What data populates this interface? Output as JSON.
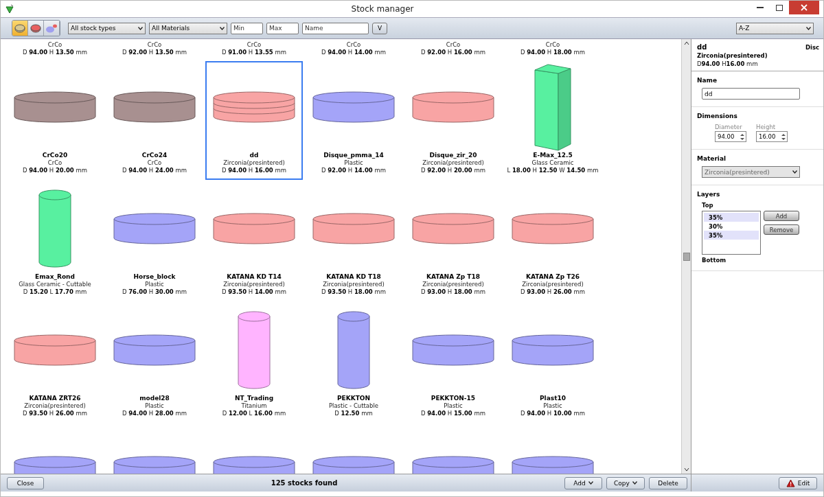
{
  "window": {
    "title": "Stock manager"
  },
  "toolbar": {
    "view_modes": [
      {
        "kind": "disc",
        "color": "#d8c890",
        "selected": true
      },
      {
        "kind": "disc",
        "color": "#e86060",
        "selected": false
      },
      {
        "kind": "pair",
        "color": "#a0a0f0",
        "selected": false
      }
    ],
    "type_filter": "All stock types",
    "material_filter": "All Materials",
    "min": {
      "placeholder": "Min"
    },
    "max": {
      "placeholder": "Max"
    },
    "name": {
      "placeholder": "Name"
    },
    "apply_button": "V",
    "sort": "A-Z"
  },
  "partial_row": [
    {
      "material": "CrCo",
      "dims": "D **94.00** H **13.50** mm"
    },
    {
      "material": "CrCo",
      "dims": "D **92.00** H **13.50** mm"
    },
    {
      "material": "CrCo",
      "dims": "D **91.00** H **13.55** mm"
    },
    {
      "material": "CrCo",
      "dims": "D **94.00** H **14.00** mm"
    },
    {
      "material": "CrCo",
      "dims": "D **92.00** H **16.00** mm"
    },
    {
      "material": "CrCo",
      "dims": "D **94.00** H **18.00** mm"
    }
  ],
  "stocks": [
    {
      "name": "CrCo20",
      "material": "CrCo",
      "dims": "D **94.00** H **20.00** mm",
      "kind": "disc",
      "color": "#a89090",
      "selected": false
    },
    {
      "name": "CrCo24",
      "material": "CrCo",
      "dims": "D **94.00** H **24.00** mm",
      "kind": "disc",
      "color": "#a89090",
      "selected": false
    },
    {
      "name": "dd",
      "material": "Zirconia(presintered)",
      "dims": "D **94.00** H **16.00** mm",
      "kind": "layered",
      "color": "#f8a4a4",
      "selected": true
    },
    {
      "name": "Disque_pmma_14",
      "material": "Plastic",
      "dims": "D **92.00** H **14.00** mm",
      "kind": "disc",
      "color": "#a4a4f8",
      "selected": false
    },
    {
      "name": "Disque_zir_20",
      "material": "Zirconia(presintered)",
      "dims": "D **92.00** H **20.00** mm",
      "kind": "disc",
      "color": "#f8a4a4",
      "selected": false
    },
    {
      "name": "E-Max_12.5",
      "material": "Glass Ceramic",
      "dims": "L **18.00** H **12.50** W **14.50** mm",
      "kind": "block",
      "color": "#58f0a0",
      "selected": false
    },
    {
      "name": "Emax_Rond",
      "material": "Glass Ceramic - Cuttable",
      "dims": "D **15.20** L **17.70** mm",
      "kind": "rod",
      "color": "#58f0a0",
      "selected": false
    },
    {
      "name": "Horse_block",
      "material": "Plastic",
      "dims": "D **76.00** H **30.00** mm",
      "kind": "disc",
      "color": "#a4a4f8",
      "selected": false
    },
    {
      "name": "KATANA KD T14",
      "material": "Zirconia(presintered)",
      "dims": "D **93.50** H **14.00** mm",
      "kind": "disc",
      "color": "#f8a4a4",
      "selected": false
    },
    {
      "name": "KATANA KD T18",
      "material": "Zirconia(presintered)",
      "dims": "D **93.50** H **18.00** mm",
      "kind": "disc",
      "color": "#f8a4a4",
      "selected": false
    },
    {
      "name": "KATANA Zp T18",
      "material": "Zirconia(presintered)",
      "dims": "D **93.00** H **18.00** mm",
      "kind": "disc",
      "color": "#f8a4a4",
      "selected": false
    },
    {
      "name": "KATANA Zp T26",
      "material": "Zirconia(presintered)",
      "dims": "D **93.00** H **26.00** mm",
      "kind": "disc",
      "color": "#f8a4a4",
      "selected": false
    },
    {
      "name": "KATANA ZRT26",
      "material": "Zirconia(presintered)",
      "dims": "D **93.50** H **26.00** mm",
      "kind": "disc",
      "color": "#f8a4a4",
      "selected": false
    },
    {
      "name": "model28",
      "material": "Plastic",
      "dims": "D **94.00** H **28.00** mm",
      "kind": "disc",
      "color": "#a4a4f8",
      "selected": false
    },
    {
      "name": "NT_Trading",
      "material": "Titanium",
      "dims": "D **12.00** L **16.00** mm",
      "kind": "rod",
      "color": "#ffb4ff",
      "selected": false
    },
    {
      "name": "PEKKTON",
      "material": "Plastic - Cuttable",
      "dims": "D **12.50** mm",
      "kind": "rod",
      "color": "#a4a4f8",
      "selected": false
    },
    {
      "name": "PEKKTON-15",
      "material": "Plastic",
      "dims": "D **94.00** H **15.00** mm",
      "kind": "disc",
      "color": "#a4a4f8",
      "selected": false
    },
    {
      "name": "Plast10",
      "material": "Plastic",
      "dims": "D **94.00** H **10.00** mm",
      "kind": "disc",
      "color": "#a4a4f8",
      "selected": false
    },
    {
      "kind": "disc",
      "color": "#a4a4f8",
      "selected": false
    },
    {
      "kind": "disc",
      "color": "#a4a4f8",
      "selected": false
    },
    {
      "kind": "disc",
      "color": "#a4a4f8",
      "selected": false
    },
    {
      "kind": "disc",
      "color": "#a4a4f8",
      "selected": false
    },
    {
      "kind": "disc",
      "color": "#a4a4f8",
      "selected": false
    },
    {
      "kind": "disc",
      "color": "#a4a4f8",
      "selected": false
    }
  ],
  "detail": {
    "name": "dd",
    "type": "Disc",
    "material": "Zirconia(presintered)",
    "dims": "D**94.00** H**16.00** mm",
    "name_label": "Name",
    "name_value": "dd",
    "dimensions_label": "Dimensions",
    "diameter_label": "Diameter",
    "diameter_value": "94.00",
    "height_label": "Height",
    "height_value": "16.00",
    "material_label": "Material",
    "material_value": "Zirconia(presintered)",
    "layers_label": "Layers",
    "top_label": "Top",
    "bottom_label": "Bottom",
    "layers": [
      {
        "label": "35%",
        "selected": true
      },
      {
        "label": "30%",
        "selected": false
      },
      {
        "label": "35%",
        "selected": true
      }
    ],
    "add_button": "Add",
    "remove_button": "Remove"
  },
  "footer": {
    "close": "Close",
    "count": "125 stocks found",
    "add": "Add",
    "copy": "Copy",
    "delete": "Delete",
    "edit": "Edit"
  }
}
